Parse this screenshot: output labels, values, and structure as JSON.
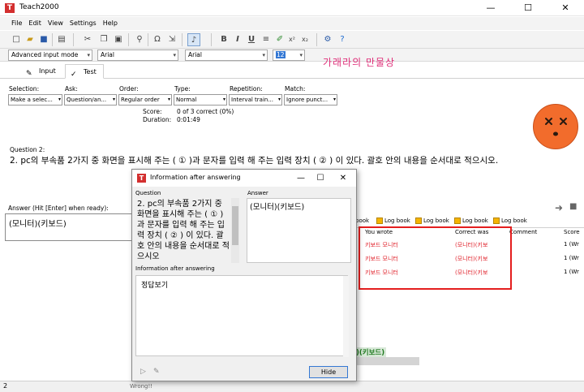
{
  "window": {
    "title": "Teach2000",
    "logo_letter": "T",
    "minimize": "—",
    "maximize": "☐",
    "close": "✕"
  },
  "menu": [
    "File",
    "Edit",
    "View",
    "Settings",
    "Help"
  ],
  "toolbar": {
    "format_buttons": [
      "B",
      "I",
      "U",
      "x²",
      "x₂"
    ],
    "omega": "Ω",
    "music": "♪"
  },
  "combos": {
    "input_mode": "Advanced input mode",
    "font1": "Arial",
    "font2": "Arial",
    "size": "12"
  },
  "tabs": [
    {
      "label": "Input",
      "icon": "✎"
    },
    {
      "label": "Test",
      "icon": "✓"
    }
  ],
  "options": [
    {
      "label": "Selection:",
      "value": "Make a selec..."
    },
    {
      "label": "Ask:",
      "value": "Question/an..."
    },
    {
      "label": "Order:",
      "value": "Regular order"
    },
    {
      "label": "Type:",
      "value": "Normal"
    },
    {
      "label": "Repetition:",
      "value": "Interval train..."
    },
    {
      "label": "Match:",
      "value": "Ignore punct..."
    }
  ],
  "stats": {
    "score_label": "Score:",
    "score_value": "0 of 3 correct (0%)",
    "duration_label": "Duration:",
    "duration_value": "0:01:49"
  },
  "watermark": "가래라의 만물상",
  "question": {
    "header": "Question 2:",
    "text": "2. pc의 부속품 2가지 중 화면을 표시해 주는 ( ① )과 문자를 입력 해 주는 입력 장치 ( ② ) 이 있다. 괄호 안의 내용을 순서대로 적으시오."
  },
  "answer": {
    "label": "Answer (Hit [Enter] when ready):",
    "value": "(모니터)(키보드)"
  },
  "log": {
    "tabs": [
      "book",
      "Log book",
      "Log book",
      "Log book",
      "Log book"
    ],
    "headers": {
      "you_wrote": "You wrote",
      "correct_was": "Correct was",
      "comment": "Comment",
      "score": "Score"
    },
    "rows": [
      {
        "you_wrote": "키보드 모니터",
        "correct_was": "(모니터)(키보",
        "score": "1 (Wr"
      },
      {
        "you_wrote": "키보드 모니터",
        "correct_was": "(모니터)(키보",
        "score": "1 (Wr"
      },
      {
        "you_wrote": "키보드 모니터",
        "correct_was": "(모니터)(키보",
        "score": "1 (Wr"
      }
    ],
    "green_text": ")(키보드)"
  },
  "status": {
    "left": "2",
    "mid": "Wrong!!"
  },
  "dialog": {
    "title": "Information after answering",
    "question_label": "Question",
    "answer_label": "Answer",
    "question_text": "2. pc의 부속품 2가지 중 화면을 표시해 주는 ( ① )과 문자를 입력 해 주는 입력 장치 ( ② ) 이 있다. 괄호 안의 내용을 순서대로 적으시오",
    "answer_text": "(모니터)(키보드)",
    "info_label": "Information after answering",
    "info_text": "정답보기",
    "hide_label": "Hide",
    "close": "✕",
    "maximize": "☐",
    "minimize": "—"
  }
}
